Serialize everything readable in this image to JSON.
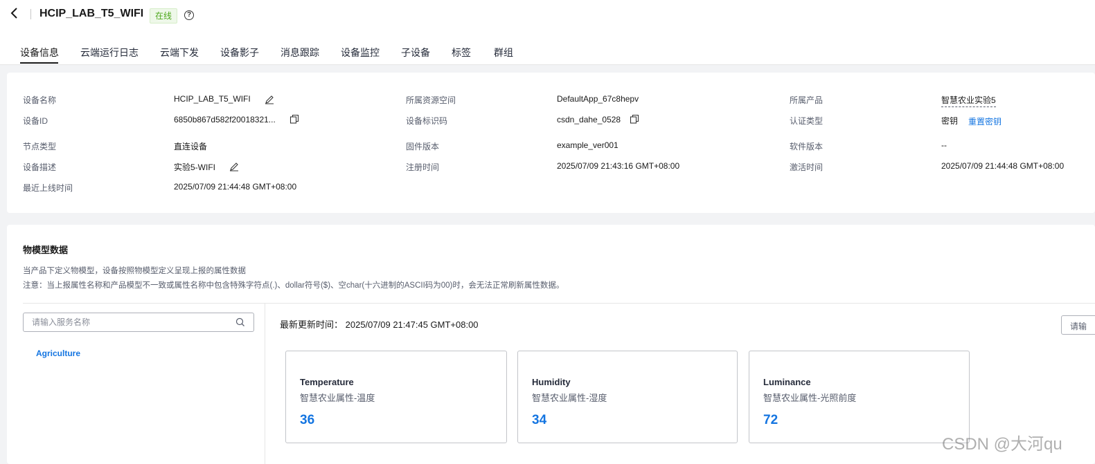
{
  "header": {
    "title": "HCIP_LAB_T5_WIFI",
    "status": "在线"
  },
  "tabs": [
    {
      "label": "设备信息",
      "active": true
    },
    {
      "label": "云端运行日志"
    },
    {
      "label": "云端下发"
    },
    {
      "label": "设备影子"
    },
    {
      "label": "消息跟踪"
    },
    {
      "label": "设备监控"
    },
    {
      "label": "子设备"
    },
    {
      "label": "标签"
    },
    {
      "label": "群组"
    }
  ],
  "info": {
    "device_name": {
      "label": "设备名称",
      "value": "HCIP_LAB_T5_WIFI"
    },
    "device_id": {
      "label": "设备ID",
      "value": "6850b867d582f20018321..."
    },
    "node_type": {
      "label": "节点类型",
      "value": "直连设备"
    },
    "device_desc": {
      "label": "设备描述",
      "value": "实验5-WIFI"
    },
    "last_online": {
      "label": "最近上线时间",
      "value": "2025/07/09 21:44:48 GMT+08:00"
    },
    "resource_space": {
      "label": "所属资源空间",
      "value": "DefaultApp_67c8hepv"
    },
    "node_id": {
      "label": "设备标识码",
      "value": "csdn_dahe_0528"
    },
    "firmware": {
      "label": "固件版本",
      "value": "example_ver001"
    },
    "register_time": {
      "label": "注册时间",
      "value": "2025/07/09 21:43:16 GMT+08:00"
    },
    "product": {
      "label": "所属产品",
      "value": "智慧农业实验5"
    },
    "auth_type": {
      "label": "认证类型",
      "value": "密钥",
      "action": "重置密钥"
    },
    "software": {
      "label": "软件版本",
      "value": "--"
    },
    "activate_time": {
      "label": "激活时间",
      "value": "2025/07/09 21:44:48 GMT+08:00"
    }
  },
  "model": {
    "title": "物模型数据",
    "note1": "当产品下定义物模型，设备按照物模型定义呈现上报的属性数据",
    "note2": "注意：当上报属性名称和产品模型不一致或属性名称中包含特殊字符点(.)、dollar符号($)、空char(十六进制的ASCII码为00)时，会无法正常刷新属性数据。",
    "search_placeholder": "请输入服务名称",
    "service": "Agriculture",
    "update_label": "最新更新时间：",
    "update_time": "2025/07/09 21:47:45 GMT+08:00",
    "right_input": "请输",
    "properties": [
      {
        "name": "Temperature",
        "desc": "智慧农业属性-温度",
        "value": "36"
      },
      {
        "name": "Humidity",
        "desc": "智慧农业属性-湿度",
        "value": "34"
      },
      {
        "name": "Luminance",
        "desc": "智慧农业属性-光照前度",
        "value": "72"
      }
    ]
  },
  "watermark": "CSDN @大河qu"
}
